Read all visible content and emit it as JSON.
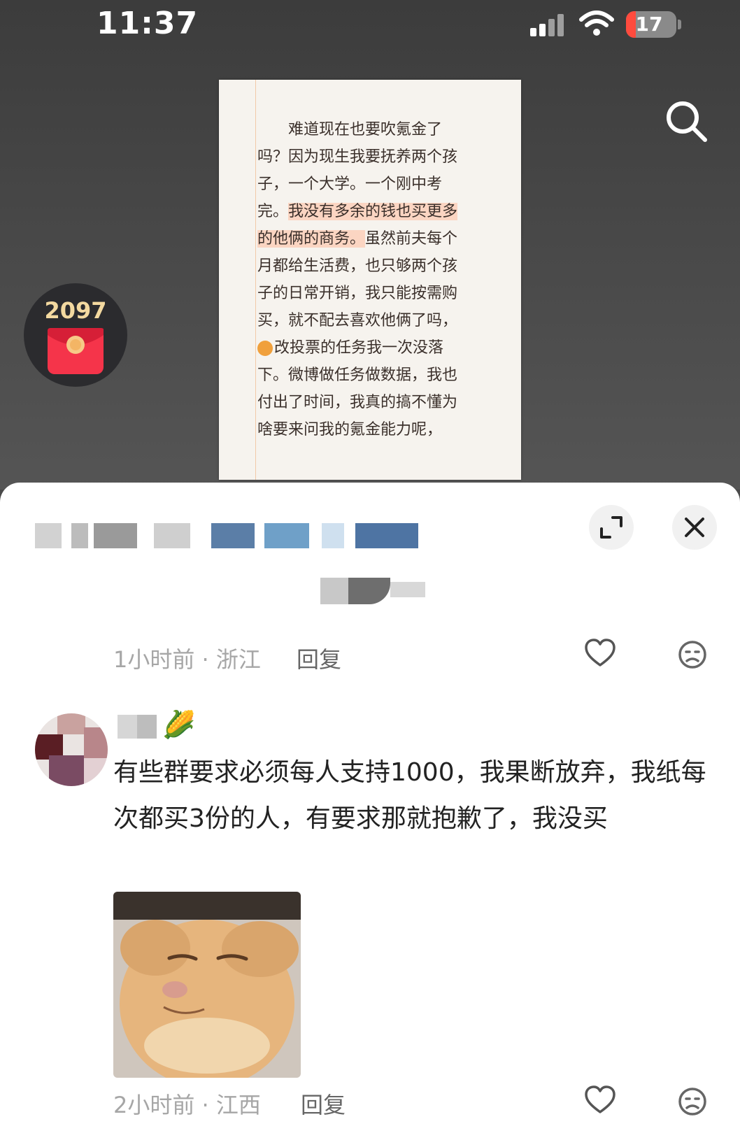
{
  "status_bar": {
    "time": "11:37",
    "battery_level": "17",
    "icons": [
      "signal-icon",
      "wifi-icon",
      "battery-icon"
    ]
  },
  "video": {
    "search_icon": "search-icon",
    "red_packet": {
      "count": "2097",
      "icon": "red-envelope-icon"
    },
    "document_text": [
      "难道现在也要吹氪金了",
      "吗？因为现生我要抚养两个孩",
      "子，一个大学。一个刚中考",
      "完。",
      "我没有多余的钱也买更多",
      "的他俩的商务。",
      "虽然前夫每个",
      "月都给生活费，也只够两个孩",
      "子的日常开销，我只能按需购",
      "买，就不配去喜欢他俩了吗，",
      "改投票的任务我一次没落",
      "下。微博做任务做数据，我也",
      "付出了时间，我真的搞不懂为",
      "啥要来问我的氪金能力呢，"
    ]
  },
  "comment_sheet": {
    "expand_icon": "expand-icon",
    "close_icon": "close-icon",
    "first_comment": {
      "time_location": "1小时前 · 浙江",
      "reply_label": "回复"
    },
    "second_comment": {
      "emoji": "🌽",
      "text": "有些群要求必须每人支持1000，我果断放弃，我纸每次都买3份的人，有要求那就抱歉了，我没买",
      "image_icon": "cat-meme-image",
      "time_location": "2小时前 · 江西",
      "reply_label": "回复"
    },
    "action_icons": [
      "heart-icon",
      "dislike-face-icon"
    ]
  }
}
